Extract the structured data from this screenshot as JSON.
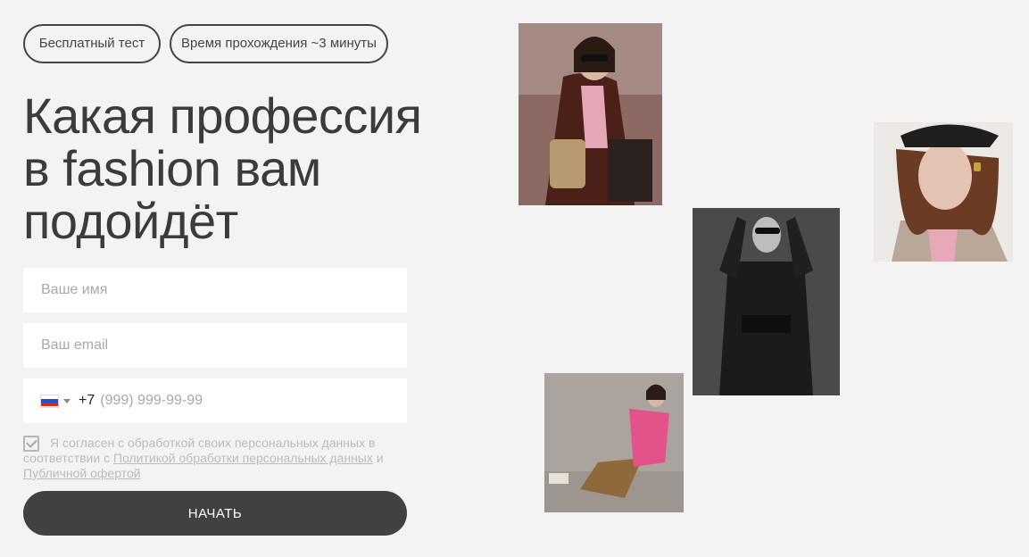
{
  "badges": {
    "free": "Бесплатный тест",
    "duration": "Время прохождения ~3 минуты"
  },
  "title": {
    "line1": "Какая профессия",
    "line2": "в fashion вам",
    "line3": "подойдёт"
  },
  "form": {
    "name_placeholder": "Ваше имя",
    "email_placeholder": "Ваш email",
    "phone_prefix": "+7",
    "phone_placeholder": "(999) 999-99-99",
    "consent_text": "Я согласен с обработкой своих персональных данных в соответствии с",
    "privacy_link": "Политикой обработки персональных данных",
    "and": "и",
    "offer_link": "Публичной офертой",
    "submit": "НАЧАТЬ"
  },
  "photos": [
    {
      "name": "woman-brown-leather-coat"
    },
    {
      "name": "woman-cap-tweed"
    },
    {
      "name": "woman-black-suit-bw"
    },
    {
      "name": "woman-pink-blouse-gold-skirt"
    }
  ]
}
